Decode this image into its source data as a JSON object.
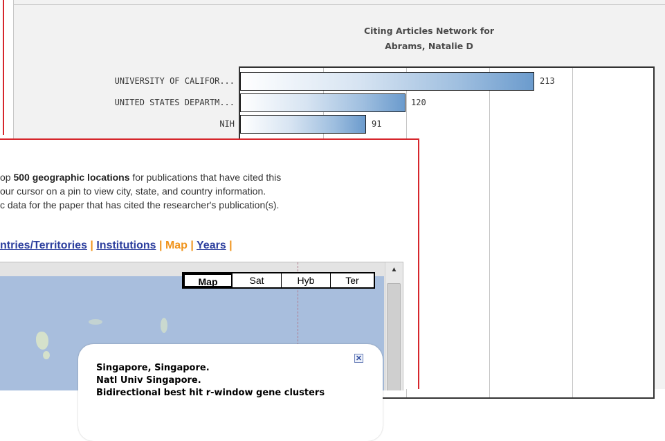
{
  "chart": {
    "title_line1": "Citing Articles Network for",
    "title_line2": "Abrams, Natalie D"
  },
  "chart_data": {
    "type": "bar",
    "orientation": "horizontal",
    "categories": [
      "UNIVERSITY OF CALIFOR...",
      "UNITED STATES DEPARTM...",
      "NIH"
    ],
    "values": [
      213,
      120,
      91
    ],
    "value_labels": [
      "213",
      "120",
      "91"
    ],
    "title": "Citing Articles Network for Abrams, Natalie D",
    "grid": true
  },
  "popup": {
    "desc_part1": "op ",
    "desc_bold": "500 geographic locations",
    "desc_part2": " for publications that have cited this",
    "desc_line2": "our cursor on a pin to view city, state, and country information.",
    "desc_line3": "c data for the paper that has cited the researcher's publication(s).",
    "tabs": {
      "countries": "ntries/Territories",
      "sep1": " | ",
      "institutions": "Institutions",
      "sep2": " | ",
      "map": "Map",
      "sep3": " | ",
      "years": "Years",
      "sep4": " |"
    },
    "map_type": [
      "Map",
      "Sat",
      "Hyb",
      "Ter"
    ],
    "info": {
      "line1": "Singapore, Singapore.",
      "line2": "Natl Univ Singapore.",
      "line3": "Bidirectional best hit r-window gene clusters",
      "close_icon": "close-icon"
    }
  }
}
